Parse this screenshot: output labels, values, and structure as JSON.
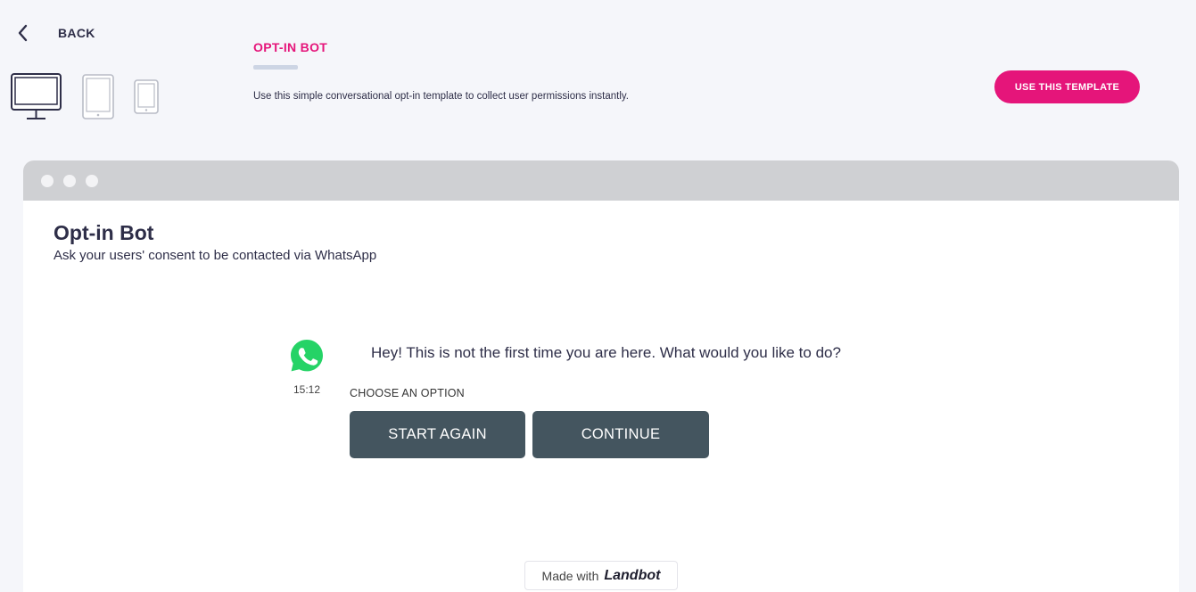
{
  "header": {
    "back_label": "BACK",
    "devices": [
      "desktop-icon",
      "tablet-icon",
      "phone-icon"
    ],
    "template_title": "OPT-IN BOT",
    "template_description": "Use this simple conversational opt-in template to collect user permissions instantly.",
    "use_template_label": "USE THIS TEMPLATE"
  },
  "preview": {
    "bot_title": "Opt-in Bot",
    "bot_subtitle": "Ask your users' consent to be contacted via WhatsApp",
    "message": {
      "avatar": "whatsapp-icon",
      "time": "15:12",
      "text": "Hey! This is not the first time you are here. What would you like to do?"
    },
    "choose_label": "CHOOSE AN OPTION",
    "options": [
      "START AGAIN",
      "CONTINUE"
    ],
    "made_with": {
      "prefix": "Made with",
      "brand": "Landbot"
    }
  },
  "colors": {
    "accent": "#e5157a",
    "option_button": "#44555f",
    "whatsapp": "#25d366",
    "browser_bar": "#cfd0d3",
    "page_bg": "#f5f6fa"
  }
}
